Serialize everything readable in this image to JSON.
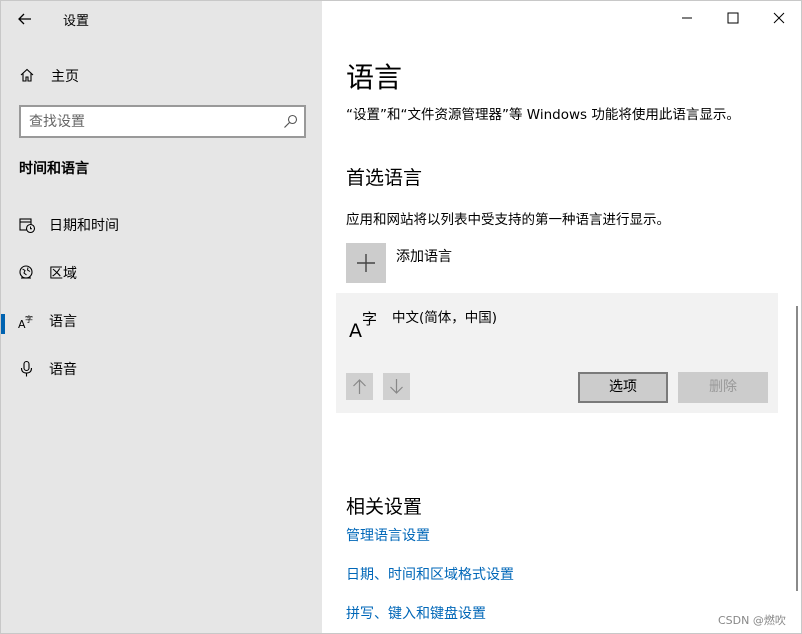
{
  "window": {
    "title": "设置",
    "controls": {
      "minimize": "minimize",
      "maximize": "maximize",
      "close": "close"
    }
  },
  "sidebar": {
    "home_label": "主页",
    "search_placeholder": "查找设置",
    "section_title": "时间和语言",
    "items": [
      {
        "label": "日期和时间",
        "icon": "calendar-clock-icon",
        "active": false
      },
      {
        "label": "区域",
        "icon": "globe-icon",
        "active": false
      },
      {
        "label": "语言",
        "icon": "language-icon",
        "active": true
      },
      {
        "label": "语音",
        "icon": "microphone-icon",
        "active": false
      }
    ]
  },
  "main": {
    "title": "语言",
    "description": "“设置”和“文件资源管理器”等 Windows 功能将使用此语言显示。",
    "preferred_heading": "首选语言",
    "preferred_description": "应用和网站将以列表中受支持的第一种语言进行显示。",
    "add_language_label": "添加语言",
    "language_entry": {
      "name": "中文(简体，中国)",
      "options_label": "选项",
      "remove_label": "删除"
    },
    "related_heading": "相关设置",
    "related_links": [
      "管理语言设置",
      "日期、时间和区域格式设置",
      "拼写、键入和键盘设置"
    ]
  },
  "watermark": "CSDN @燃吹",
  "colors": {
    "sidebar_bg": "#e6e6e6",
    "accent": "#0063b1",
    "link": "#0067b8",
    "card_bg": "#f2f2f2"
  }
}
